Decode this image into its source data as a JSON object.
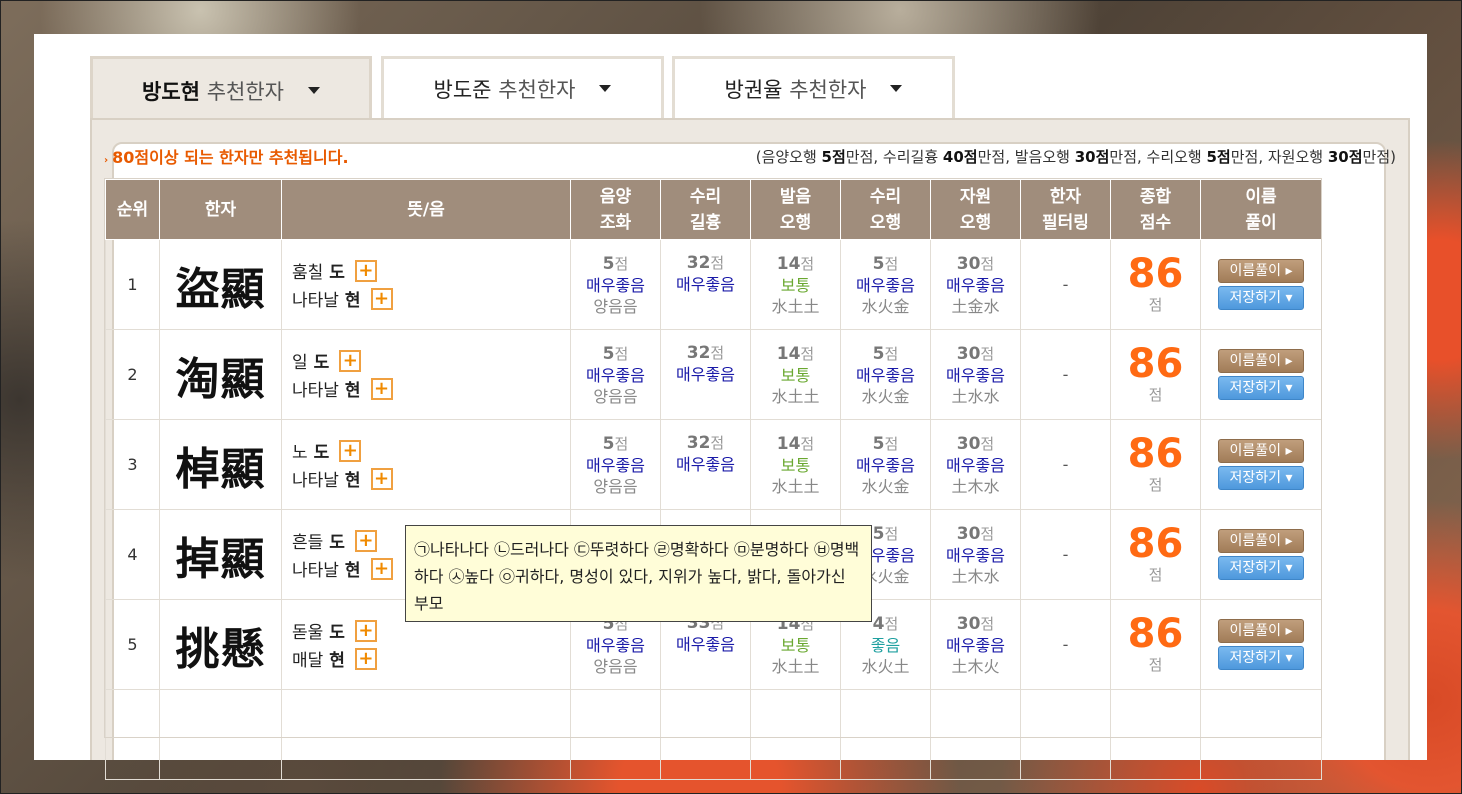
{
  "tabs": [
    {
      "name": "방도현",
      "suffix": "추천한자",
      "active": true
    },
    {
      "name": "방도준",
      "suffix": "추천한자",
      "active": false
    },
    {
      "name": "방권율",
      "suffix": "추천한자",
      "active": false
    }
  ],
  "notice": "80점이상 되는 한자만 추천됩니다.",
  "scores_note": {
    "open": "(음양오행 ",
    "a": "5점",
    "a_s": "만점, 수리길흉 ",
    "b": "40점",
    "b_s": "만점, 발음오행 ",
    "c": "30점",
    "c_s": "만점, 수리오행 ",
    "d": "5점",
    "d_s": "만점, 자원오행 ",
    "e": "30점",
    "e_s": "만점)"
  },
  "headers": {
    "rank": "순위",
    "hanja": "한자",
    "meaning": "뜻/음",
    "yinyang_1": "음양",
    "yinyang_2": "조화",
    "suri_1": "수리",
    "suri_2": "길흉",
    "bal_1": "발음",
    "bal_2": "오행",
    "suriohang_1": "수리",
    "suriohang_2": "오행",
    "jawon_1": "자원",
    "jawon_2": "오행",
    "filter_1": "한자",
    "filter_2": "필터링",
    "total_1": "종합",
    "total_2": "점수",
    "analysis_1": "이름",
    "analysis_2": "풀이"
  },
  "unit": "점",
  "buttons": {
    "analyze": "이름풀이 ▸",
    "save": "저장하기 ▾"
  },
  "rows": [
    {
      "rank": "1",
      "hanja": "盜顯",
      "m1": "훔칠",
      "r1": "도",
      "m2": "나타날",
      "r2": "현",
      "yy": "5",
      "yy_g": "매우좋음",
      "yy_s": "양음음",
      "sr": "32",
      "sr_g": "매우좋음",
      "bo": "14",
      "bo_g": "보통",
      "bo_s": "水土土",
      "so": "5",
      "so_g": "매우좋음",
      "so_s": "水火金",
      "jw": "30",
      "jw_g": "매우좋음",
      "jw_s": "土金水",
      "filter": "-",
      "total": "86"
    },
    {
      "rank": "2",
      "hanja": "淘顯",
      "m1": "일",
      "r1": "도",
      "m2": "나타날",
      "r2": "현",
      "yy": "5",
      "yy_g": "매우좋음",
      "yy_s": "양음음",
      "sr": "32",
      "sr_g": "매우좋음",
      "bo": "14",
      "bo_g": "보통",
      "bo_s": "水土土",
      "so": "5",
      "so_g": "매우좋음",
      "so_s": "水火金",
      "jw": "30",
      "jw_g": "매우좋음",
      "jw_s": "土水水",
      "filter": "-",
      "total": "86"
    },
    {
      "rank": "3",
      "hanja": "棹顯",
      "m1": "노",
      "r1": "도",
      "m2": "나타날",
      "r2": "현",
      "yy": "5",
      "yy_g": "매우좋음",
      "yy_s": "양음음",
      "sr": "32",
      "sr_g": "매우좋음",
      "bo": "14",
      "bo_g": "보통",
      "bo_s": "水土土",
      "so": "5",
      "so_g": "매우좋음",
      "so_s": "水火金",
      "jw": "30",
      "jw_g": "매우좋음",
      "jw_s": "土木水",
      "filter": "-",
      "total": "86"
    },
    {
      "rank": "4",
      "hanja": "掉顯",
      "m1": "흔들",
      "r1": "도",
      "m2": "나타날",
      "r2": "현",
      "yy": "",
      "yy_g": "",
      "yy_s": "",
      "sr": "",
      "sr_g": "",
      "bo": "",
      "bo_g": "",
      "bo_s": "",
      "so": "5",
      "so_g": "매우좋음",
      "so_s": "水火金",
      "jw": "30",
      "jw_g": "매우좋음",
      "jw_s": "土木水",
      "filter": "-",
      "total": "86"
    },
    {
      "rank": "5",
      "hanja": "挑懸",
      "m1": "돋울",
      "r1": "도",
      "m2": "매달",
      "r2": "현",
      "yy": "5",
      "yy_g": "매우좋음",
      "yy_s": "양음음",
      "sr": "33",
      "sr_g": "매우좋음",
      "bo": "14",
      "bo_g": "보통",
      "bo_s": "水土土",
      "so": "4",
      "so_g": "좋음",
      "so_s": "水火土",
      "jw": "30",
      "jw_g": "매우좋음",
      "jw_s": "土木火",
      "filter": "-",
      "total": "86"
    }
  ],
  "tooltip": "㉠나타나다 ㉡드러나다 ㉢뚜렷하다 ㉣명확하다 ㉤분명하다 ㉥명백하다 ㉦높다 ㉧귀하다, 명성이 있다, 지위가 높다, 밝다, 돌아가신 부모",
  "colors": {
    "accent_orange": "#ff6a13",
    "header_brown": "#a08d7c",
    "grade_blue": "#1a1aa8",
    "grade_green": "#6aa830",
    "grade_teal": "#1fa0a0"
  }
}
